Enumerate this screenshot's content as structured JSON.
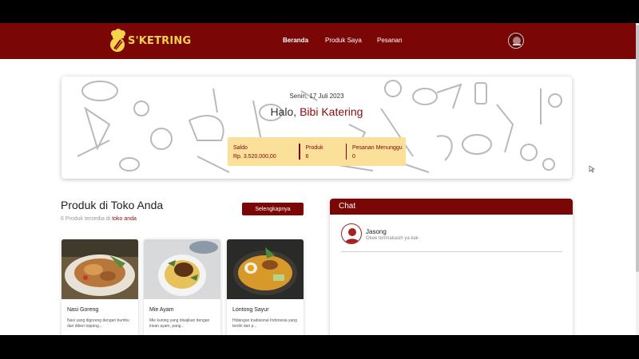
{
  "brand": {
    "name": "S'KETRING",
    "accent": "#7a0606",
    "logo_color": "#f7d34a"
  },
  "nav": {
    "items": [
      {
        "label": "Beranda",
        "active": true
      },
      {
        "label": "Produk Saya",
        "active": false
      },
      {
        "label": "Pesanan",
        "active": false
      }
    ]
  },
  "hero": {
    "date": "Senin, 17 Juli 2023",
    "greeting_prefix": "Halo, ",
    "name": "Bibi Katering",
    "stats": [
      {
        "label": "Saldo",
        "value": "Rp. 3.520.000,00"
      },
      {
        "label": "Produk",
        "value": "6"
      },
      {
        "label": "Pesanan Menunggu",
        "value": "0"
      }
    ]
  },
  "products": {
    "title": "Produk di Toko Anda",
    "subtitle_prefix": "6 Produk tersedia di ",
    "subtitle_link": "toko anda",
    "more_button": "Selengkapnya",
    "items": [
      {
        "name": "Nasi Goreng",
        "desc": "Nasi yang digoreng dengan bumbu dan diberi topping..."
      },
      {
        "name": "Mie Ayam",
        "desc": "Mie kuning yang disajikan dengan irisan ayam, pang..."
      },
      {
        "name": "Lontong Sayur",
        "desc": "Hidangan tradisional Indonesia yang terdiri dari p..."
      }
    ]
  },
  "chat": {
    "title": "Chat",
    "conversations": [
      {
        "name": "Jasong",
        "last_message": "Okee terimakasih ya kak"
      }
    ]
  }
}
